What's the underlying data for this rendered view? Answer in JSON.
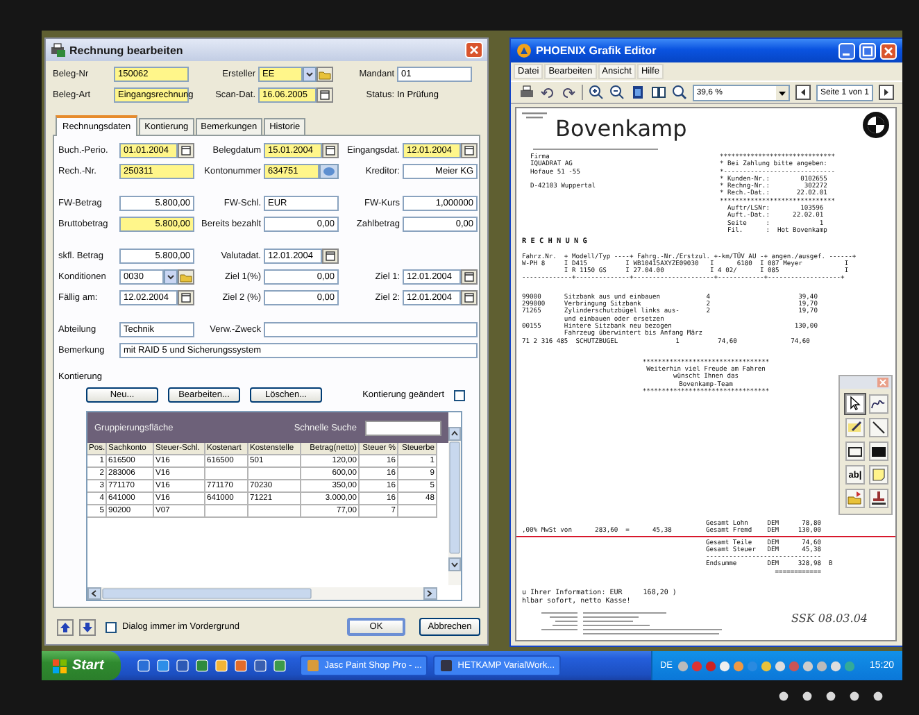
{
  "dialog": {
    "title": "Rechnung bearbeiten",
    "header": [
      [
        {
          "label": "Beleg-Nr",
          "value": "150062",
          "kind": "text",
          "highlight": true
        },
        {
          "label": "Ersteller",
          "value": "EE",
          "kind": "combo",
          "highlight": true
        },
        {
          "label": "Mandant",
          "value": "01",
          "kind": "text",
          "highlight": false
        }
      ],
      [
        {
          "label": "Beleg-Art",
          "value": "Eingangsrechnung",
          "kind": "text",
          "highlight": true
        },
        {
          "label": "Scan-Dat.",
          "value": "16.06.2005",
          "kind": "date",
          "highlight": true
        },
        {
          "label": "Status:",
          "value": "In Prüfung",
          "kind": "status"
        }
      ]
    ],
    "tabs": [
      {
        "label": "Rechnungsdaten",
        "selected": true
      },
      {
        "label": "Kontierung",
        "selected": false
      },
      {
        "label": "Bemerkungen",
        "selected": false
      },
      {
        "label": "Historie",
        "selected": false
      }
    ],
    "sections": [
      [
        [
          {
            "label": "Buch.-Perio.",
            "value": "01.01.2004",
            "kind": "date",
            "highlight": true
          },
          {
            "label": "Belegdatum",
            "value": "15.01.2004",
            "kind": "date",
            "highlight": true
          },
          {
            "label": "Eingangsdat.",
            "value": "12.01.2004",
            "kind": "date",
            "highlight": true
          }
        ],
        [
          {
            "label": "Rech.-Nr.",
            "value": "250311",
            "kind": "text",
            "highlight": true
          },
          {
            "label": "Kontonummer",
            "value": "634751",
            "kind": "lookup",
            "highlight": true
          },
          {
            "label": "Kreditor:",
            "value": "Meier KG",
            "kind": "amount",
            "highlight": false
          }
        ]
      ],
      [
        [
          {
            "label": "FW-Betrag",
            "value": "5.800,00",
            "kind": "amount",
            "highlight": false
          },
          {
            "label": "FW-Schl.",
            "value": "EUR",
            "kind": "text",
            "highlight": false
          },
          {
            "label": "FW-Kurs",
            "value": "1,000000",
            "kind": "amount",
            "highlight": false
          }
        ],
        [
          {
            "label": "Bruttobetrag",
            "value": "5.800,00",
            "kind": "amount",
            "highlight": true
          },
          {
            "label": "Bereits bezahlt",
            "value": "0,00",
            "kind": "amount",
            "highlight": false
          },
          {
            "label": "Zahlbetrag",
            "value": "0,00",
            "kind": "amount",
            "highlight": false
          }
        ]
      ],
      [
        [
          {
            "label": "skfl. Betrag",
            "value": "5.800,00",
            "kind": "amount",
            "highlight": false
          },
          {
            "label": "Valutadat.",
            "value": "12.01.2004",
            "kind": "date",
            "highlight": false
          }
        ],
        [
          {
            "label": "Konditionen",
            "value": "0030",
            "kind": "combo",
            "highlight": false
          },
          {
            "label": "Ziel 1(%)",
            "value": "0,00",
            "kind": "amount",
            "highlight": false
          },
          {
            "label": "Ziel 1:",
            "value": "12.01.2004",
            "kind": "date",
            "highlight": false
          }
        ],
        [
          {
            "label": "Fällig am:",
            "value": "12.02.2004",
            "kind": "date",
            "highlight": false
          },
          {
            "label": "Ziel 2 (%)",
            "value": "0,00",
            "kind": "amount",
            "highlight": false
          },
          {
            "label": "Ziel 2:",
            "value": "12.01.2004",
            "kind": "date",
            "highlight": false
          }
        ]
      ],
      [
        [
          {
            "label": "Abteilung",
            "value": "Technik",
            "kind": "text",
            "highlight": false
          },
          {
            "label": "Verw.-Zweck",
            "kind": "wide",
            "highlight": false
          }
        ],
        [
          {
            "label": "Bemerkung",
            "value": "mit RAID 5 und Sicherungssystem",
            "kind": "full",
            "highlight": false
          }
        ]
      ]
    ],
    "posting": {
      "label": "Kontierung",
      "buttons": [
        "Neu...",
        "Bearbeiten...",
        "Löschen..."
      ],
      "changed": {
        "label": "Kontierung geändert",
        "checked": false
      },
      "grid": {
        "group_area": "Gruppierungsfläche",
        "search_label": "Schnelle Suche",
        "columns": [
          {
            "label": "Pos.",
            "kind": "number"
          },
          {
            "label": "Sachkonto",
            "kind": "text"
          },
          {
            "label": "Steuer-Schl.",
            "kind": "text"
          },
          {
            "label": "Kostenart",
            "kind": "text"
          },
          {
            "label": "Kostenstelle",
            "kind": "text"
          },
          {
            "label": "Betrag(netto)",
            "kind": "number"
          },
          {
            "label": "Steuer %",
            "kind": "number"
          },
          {
            "label": "Steuerbe",
            "kind": "number"
          }
        ],
        "rows": [
          [
            "1",
            "616500",
            "V16",
            "616500",
            "501",
            "120,00",
            "16",
            "1"
          ],
          [
            "2",
            "283006",
            "V16",
            "",
            "",
            "600,00",
            "16",
            "9"
          ],
          [
            "3",
            "771170",
            "V16",
            "771170",
            "70230",
            "350,00",
            "16",
            "5"
          ],
          [
            "4",
            "641000",
            "V16",
            "641000",
            "71221",
            "3.000,00",
            "16",
            "48"
          ],
          [
            "5",
            "90200",
            "V07",
            "",
            "",
            "77,00",
            "7",
            ""
          ]
        ]
      }
    },
    "always_on_top": {
      "label": "Dialog immer im Vordergrund",
      "checked": false
    },
    "buttons": [
      {
        "label": "OK",
        "default": true
      },
      {
        "label": "Abbrechen",
        "default": false
      }
    ]
  },
  "editor": {
    "title": "PHOENIX Grafik Editor",
    "menu": [
      "Datei",
      "Bearbeiten",
      "Ansicht",
      "Hilfe"
    ],
    "zoom": "39,6 %",
    "page": "Seite 1 von 1",
    "document": {
      "company": "Bovenkamp",
      "address": [
        "Firma",
        "IQUADRAT AG",
        "Hofaue 51 -55",
        "D-42103 Wuppertal"
      ],
      "payment_box": [
        "******************************",
        "* Bei Zahlung bitte angeben:",
        "*-----------------------------",
        "* Kunden-Nr.:        0102655",
        "* Rechng-Nr.:         302272",
        "* Rech.-Dat.:       22.02.01",
        "******************************"
      ],
      "order_box": [
        "  Auftr/LSNr:        103596",
        "  Auft.-Dat.:      22.02.01",
        "  Seite     :             1",
        "  Fil.      :  Hot Bovenkamp"
      ],
      "heading": "R E C H N U N G",
      "table": [
        "Fahrz.Nr.  + Modell/Typ ----+ Fahrg.-Nr./Erstzul. +-km/TÜV AU -+ angen./ausgef. ------+",
        "W-PH 8     I D415          I WB10415AXYZE09030   I      6180  I 087 Meyer           I",
        "           I R 1150 GS     I 27.04.00            I 4 02/      I 085                 I",
        "-------------+--------------+---------------------+------------+-------------------+"
      ],
      "items": [
        "99000      Sitzbank aus und einbauen            4                       39,40",
        "299000     Verbringung Sitzbank                 2                       19,70",
        "71265      Zylinderschutzbügel links aus-       2                       19,70",
        "           und einbauen oder ersetzen",
        "00155      Hintere Sitzbank neu bezogen                                130,00",
        "           Fahrzeug überwintert bis Anfang März",
        "71 2 316 485  SCHUTZBUGEL               1          74,60              74,60"
      ],
      "closing": [
        "*********************************",
        "Weiterhin viel Freude am Fahren",
        "wünscht Ihnen das",
        "Bovenkamp-Team",
        "*********************************"
      ],
      "vat_line": ",00% MwSt von      283,60  =      45,38",
      "totals": [
        "Gesamt Lohn     DEM      78,80",
        "Gesamt Fremd    DEM     130,00",
        "Gesamt Teile    DEM      74,60",
        "Gesamt Steuer   DEM      45,38",
        "------------------------------",
        "Endsumme        DEM     328,98  B",
        "                  ============"
      ],
      "info": [
        "u Ihrer Information: EUR     168,20 )",
        "hlbar sofort, netto Kasse!"
      ],
      "signature": "SSK 08.03.04"
    },
    "palette": [
      {
        "kind": "pointer",
        "selected": true
      },
      {
        "kind": "curve",
        "selected": false
      },
      {
        "kind": "marker",
        "selected": false
      },
      {
        "kind": "line",
        "selected": false
      },
      {
        "kind": "rect",
        "selected": false
      },
      {
        "kind": "filled-rect",
        "selected": false
      },
      {
        "kind": "text",
        "label": "ab|",
        "selected": false
      },
      {
        "kind": "note",
        "selected": false
      },
      {
        "kind": "open",
        "selected": false
      },
      {
        "kind": "stamp",
        "selected": false
      }
    ]
  },
  "taskbar": {
    "start": "Start",
    "tasks": [
      {
        "label": "Jasc Paint Shop Pro - ...",
        "selected": false
      },
      {
        "label": "HETKAMP VarialWork...",
        "selected": false
      }
    ],
    "language": "DE",
    "clock": "15:20"
  }
}
